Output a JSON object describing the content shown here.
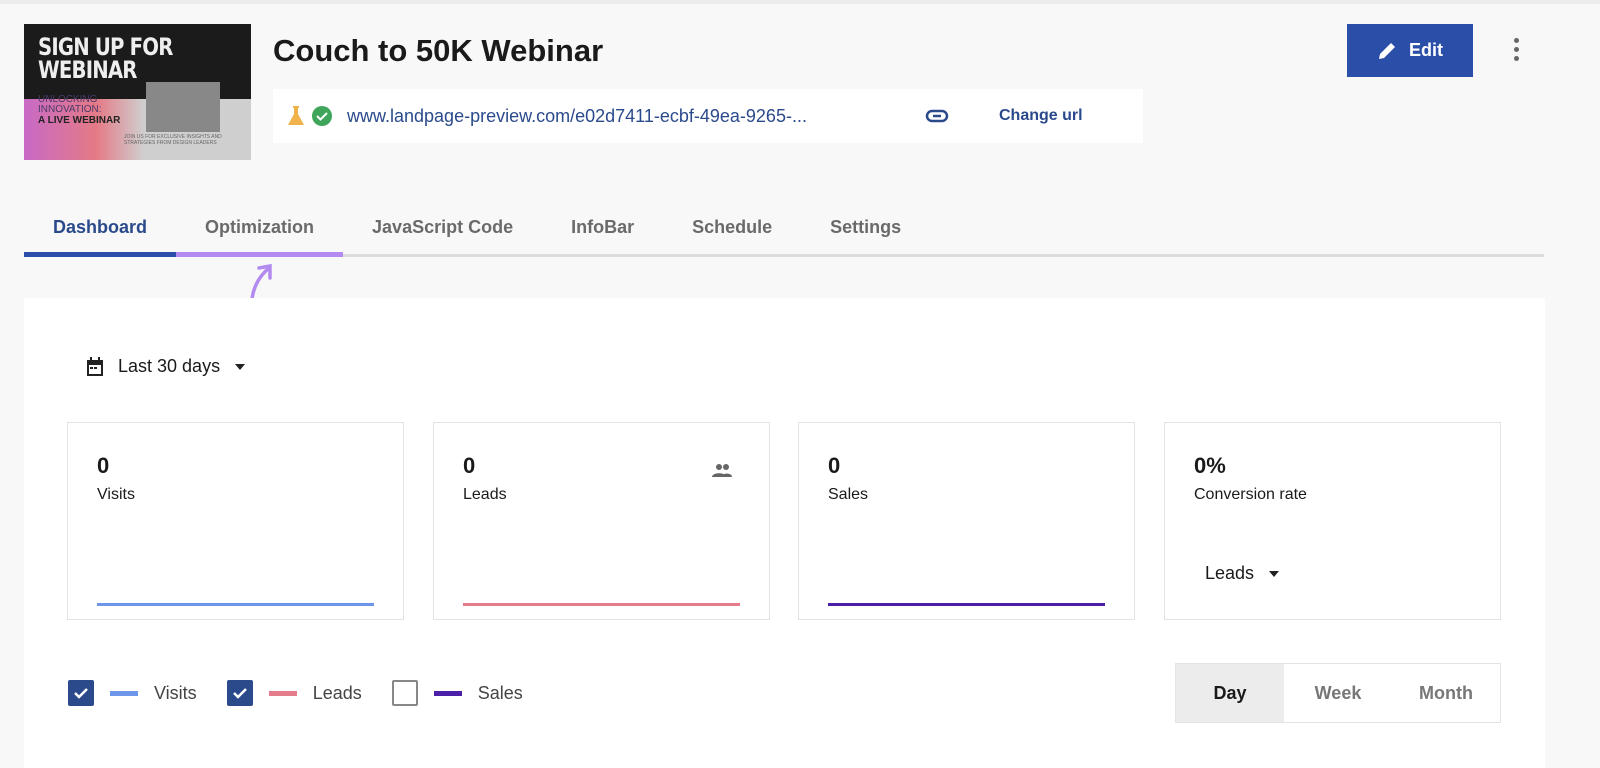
{
  "header": {
    "thumbnail": {
      "line1": "SIGN UP FOR",
      "line2": "WEBINAR",
      "sub1": "UNLOCKING",
      "sub2": "INNOVATION:",
      "sub3": "A LIVE WEBINAR",
      "body": "JOIN US FOR EXCLUSIVE INSIGHTS AND STRATEGIES FROM DESIGN LEADERS"
    },
    "title": "Couch to 50K Webinar",
    "url": "www.landpage-preview.com/e02d7411-ecbf-49ea-9265-...",
    "change_url": "Change url",
    "edit": "Edit"
  },
  "tabs": [
    {
      "label": "Dashboard",
      "active": true
    },
    {
      "label": "Optimization"
    },
    {
      "label": "JavaScript Code"
    },
    {
      "label": "InfoBar"
    },
    {
      "label": "Schedule"
    },
    {
      "label": "Settings"
    }
  ],
  "range": "Last 30 days",
  "stats": [
    {
      "value": "0",
      "label": "Visits",
      "color": "#6d96ea"
    },
    {
      "value": "0",
      "label": "Leads",
      "color": "#e47c8c"
    },
    {
      "value": "0",
      "label": "Sales",
      "color": "#4b1fa8"
    },
    {
      "value": "0%",
      "label": "Conversion rate",
      "select": "Leads"
    }
  ],
  "legend": [
    {
      "label": "Visits",
      "checked": true,
      "color": "#6d96ea"
    },
    {
      "label": "Leads",
      "checked": true,
      "color": "#e47c8c"
    },
    {
      "label": "Sales",
      "checked": false,
      "color": "#4b1fa8"
    }
  ],
  "granularity": {
    "options": [
      "Day",
      "Week",
      "Month"
    ],
    "selected": "Day"
  }
}
